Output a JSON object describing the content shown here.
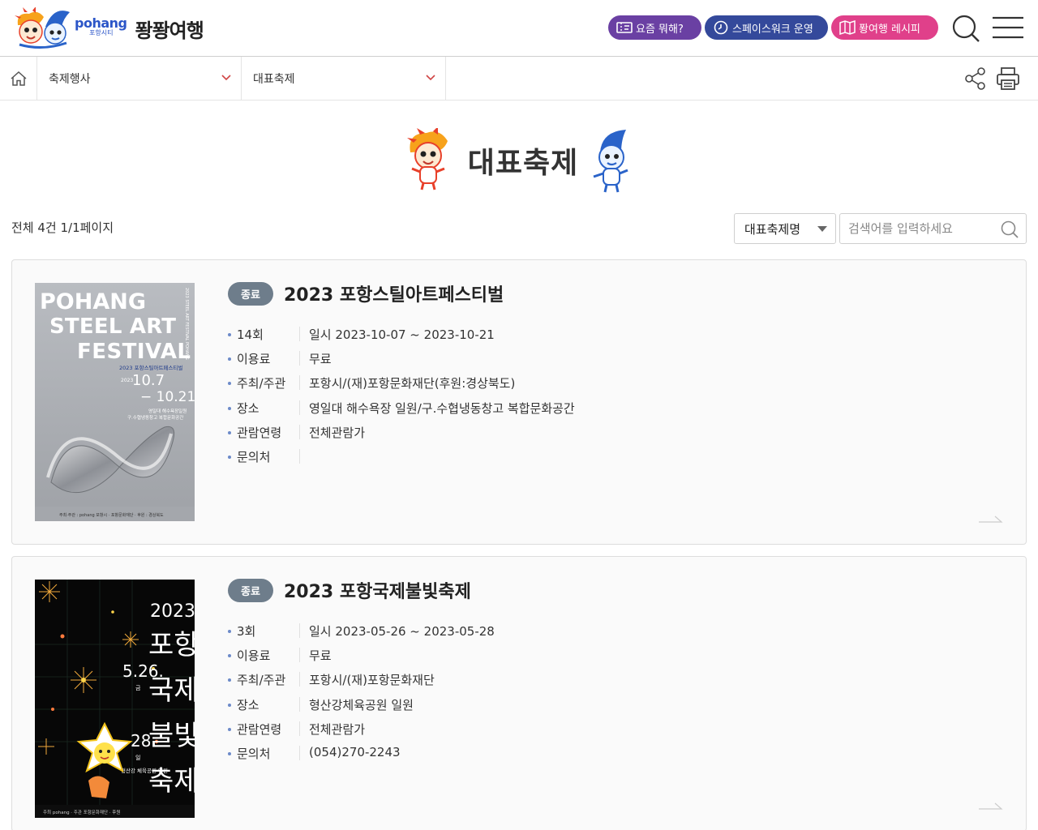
{
  "header": {
    "logo_en": "pohang",
    "logo_sub": "포항시티",
    "logo_ko": "퐝퐝여행",
    "buttons": [
      {
        "label": "요즘 뭐해?",
        "color": "#6a40a3"
      },
      {
        "label": "스페이스워크 운영",
        "color": "#34499b"
      },
      {
        "label": "퐝여행 레시피",
        "color": "#e0408a"
      }
    ]
  },
  "breadcrumb": {
    "level1": "축제행사",
    "level2": "대표축제"
  },
  "page": {
    "title": "대표축제"
  },
  "list": {
    "count_text": "전체 4건 1/1페이지",
    "filter_selected": "대표축제명",
    "search_placeholder": "검색어를 입력하세요"
  },
  "festivals": [
    {
      "status": "종료",
      "title": "2023 포항스틸아트페스티벌",
      "poster": {
        "line1": "POHANG",
        "line2": "STEEL ART",
        "line3": "FESTIVAL",
        "sub": "2023 포항스틸아트페스티벌",
        "year": "2023",
        "date_from": "10.7",
        "date_to": "− 10.21",
        "venue1": "영일대 해수욕장일원",
        "venue2": "구.수협냉동창고 복합문화공간",
        "footer": "주최·주관 : pohang 포항시 · 포항문화재단 · 후원 : 경상북도",
        "side": "2023 STEEL ART FESTIVAL POHANG"
      },
      "rows": [
        {
          "key": "14회",
          "value": "일시 2023-10-07 ~ 2023-10-21"
        },
        {
          "key": "이용료",
          "value": "무료"
        },
        {
          "key": "주최/주관",
          "value": "포항시/(재)포항문화재단(후원:경상북도)"
        },
        {
          "key": "장소",
          "value": "영일대 해수욕장 일원/구.수협냉동창고 복합문화공간"
        },
        {
          "key": "관람연령",
          "value": "전체관람가"
        },
        {
          "key": "문의처",
          "value": ""
        }
      ]
    },
    {
      "status": "종료",
      "title": "2023 포항국제불빛축제",
      "poster": {
        "year": "2023",
        "v1": "포항",
        "v2": "국제",
        "v3": "불빛",
        "v4": "축제",
        "d1": "5.26.",
        "d1w": "금",
        "d2": "28.",
        "d2w": "일",
        "place": "형산강 체육공원 일원",
        "footer": "주최 pohang · 주관 포항문화재단 · 후원"
      },
      "rows": [
        {
          "key": "3회",
          "value": "일시 2023-05-26 ~ 2023-05-28"
        },
        {
          "key": "이용료",
          "value": "무료"
        },
        {
          "key": "주최/주관",
          "value": "포항시/(재)포항문화재단"
        },
        {
          "key": "장소",
          "value": "형산강체육공원 일원"
        },
        {
          "key": "관람연령",
          "value": "전체관람가"
        },
        {
          "key": "문의처",
          "value": "(054)270-2243"
        }
      ]
    }
  ]
}
